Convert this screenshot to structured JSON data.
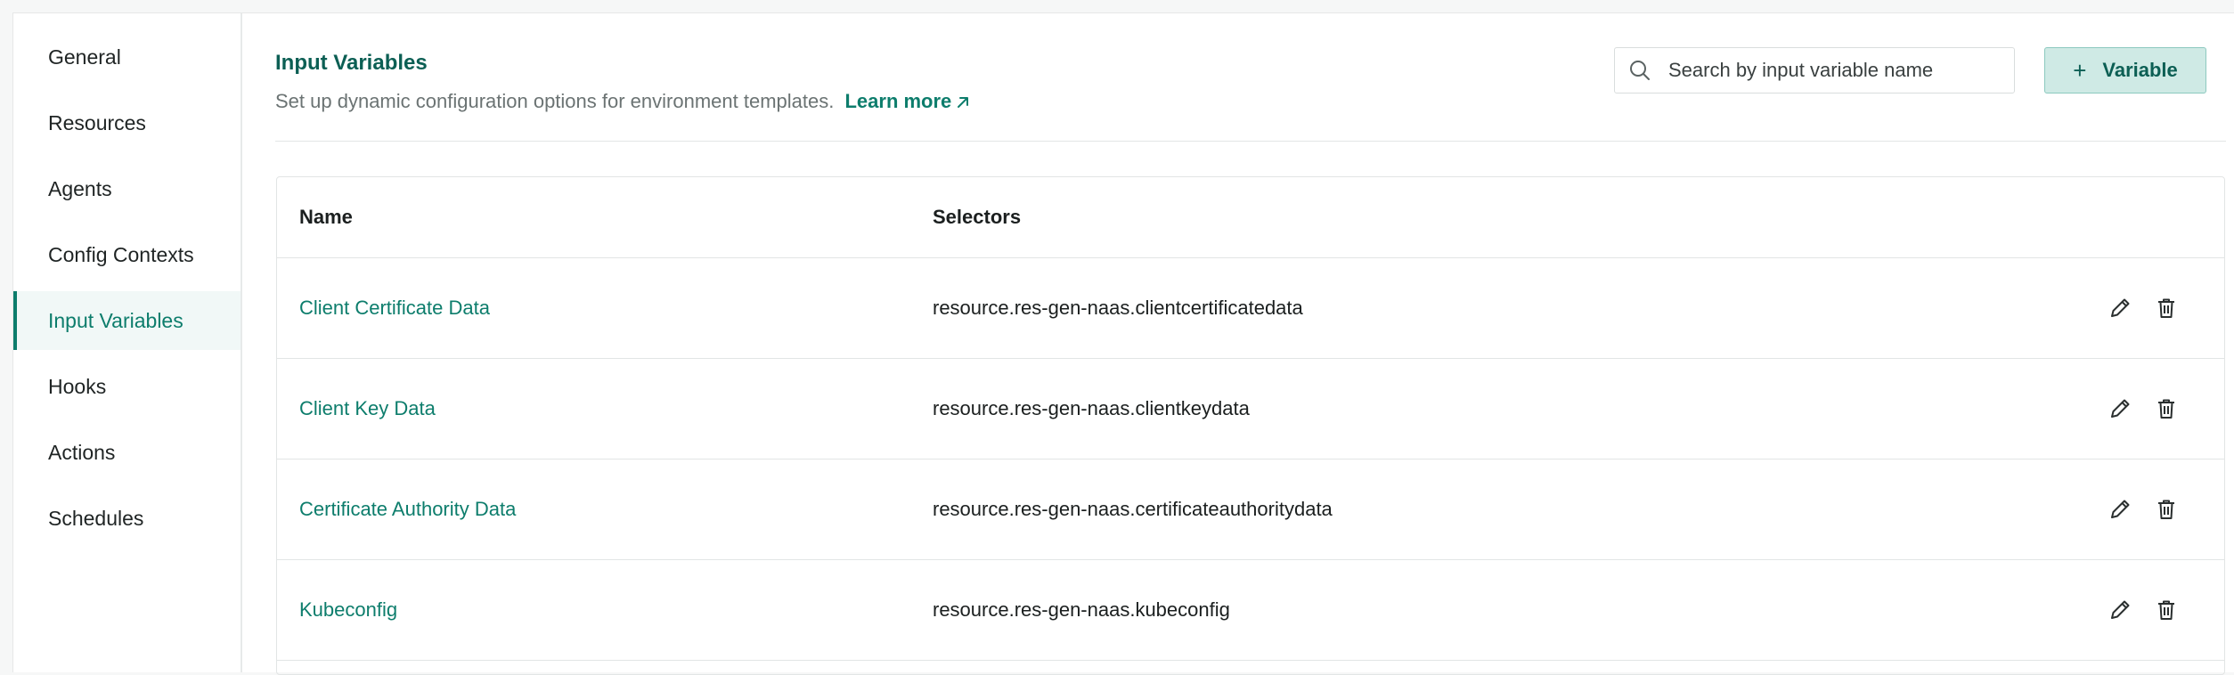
{
  "sidebar": {
    "items": [
      {
        "label": "General"
      },
      {
        "label": "Resources"
      },
      {
        "label": "Agents"
      },
      {
        "label": "Config Contexts"
      },
      {
        "label": "Input Variables",
        "active": true
      },
      {
        "label": "Hooks"
      },
      {
        "label": "Actions"
      },
      {
        "label": "Schedules"
      }
    ]
  },
  "header": {
    "title": "Input Variables",
    "subtitle": "Set up dynamic configuration options for environment templates.",
    "learn_more": "Learn more",
    "search_placeholder": "Search by input variable name",
    "add_button": "Variable"
  },
  "table": {
    "columns": [
      "Name",
      "Selectors"
    ],
    "rows": [
      {
        "name": "Client Certificate Data",
        "selector": "resource.res-gen-naas.clientcertificatedata"
      },
      {
        "name": "Client Key Data",
        "selector": "resource.res-gen-naas.clientkeydata"
      },
      {
        "name": "Certificate Authority Data",
        "selector": "resource.res-gen-naas.certificateauthoritydata"
      },
      {
        "name": "Kubeconfig",
        "selector": "resource.res-gen-naas.kubeconfig"
      }
    ]
  },
  "icons": {
    "search": "search-icon",
    "external_link": "arrow-up-right-icon",
    "plus": "plus-icon",
    "edit": "pencil-icon",
    "delete": "trash-icon"
  },
  "colors": {
    "accent": "#0d7d6c",
    "title": "#0c5f54",
    "button_bg": "#cfeae5",
    "active_nav_bg": "#f1f8f7"
  }
}
